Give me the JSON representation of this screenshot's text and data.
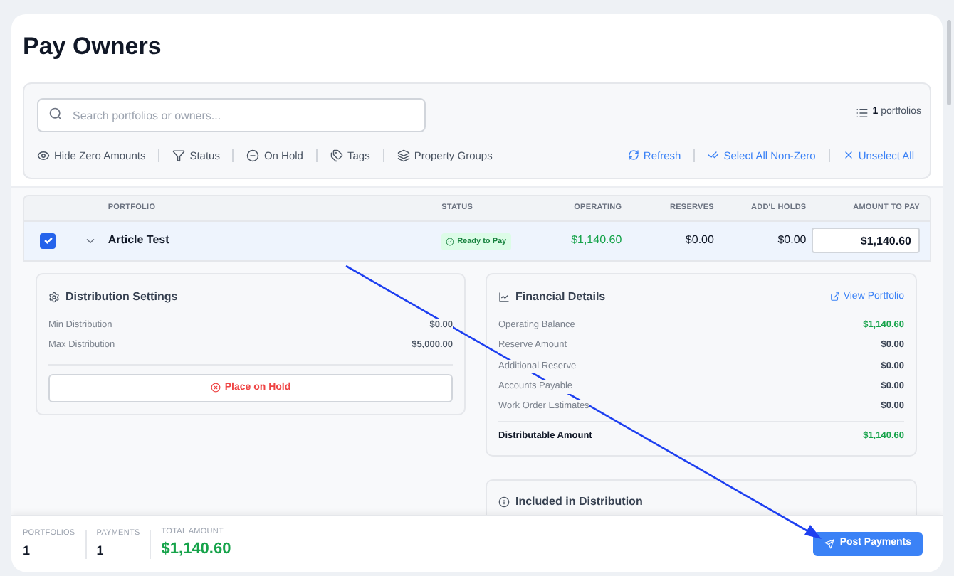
{
  "page": {
    "title": "Pay Owners"
  },
  "search": {
    "placeholder": "Search portfolios or owners..."
  },
  "portfolio_count": {
    "count": "1",
    "label": "portfolios"
  },
  "filters": [
    {
      "kind": "eye",
      "label": "Hide Zero Amounts"
    },
    {
      "kind": "filter",
      "label": "Status"
    },
    {
      "kind": "hold",
      "label": "On Hold"
    },
    {
      "kind": "tags",
      "label": "Tags"
    },
    {
      "kind": "layers",
      "label": "Property Groups"
    }
  ],
  "actions": [
    {
      "kind": "refresh",
      "label": "Refresh"
    },
    {
      "kind": "check",
      "label": "Select All Non-Zero"
    },
    {
      "kind": "x",
      "label": "Unselect All"
    }
  ],
  "table": {
    "columns": [
      "PORTFOLIO",
      "STATUS",
      "OPERATING",
      "RESERVES",
      "ADD'L HOLDS",
      "AMOUNT TO PAY"
    ],
    "rows": [
      {
        "checked": true,
        "expanded": true,
        "portfolio": "Article Test",
        "status": "Ready to Pay",
        "operating": "$1,140.60",
        "reserves": "$0.00",
        "holds": "$0.00",
        "amount": "$1,140.60"
      }
    ]
  },
  "distribution_settings": {
    "title": "Distribution Settings",
    "rows": [
      {
        "label": "Min Distribution",
        "value": "$0.00"
      },
      {
        "label": "Max Distribution",
        "value": "$5,000.00"
      }
    ],
    "button": "Place on Hold"
  },
  "financial_details": {
    "title": "Financial Details",
    "link": "View Portfolio",
    "rows": [
      {
        "label": "Operating Balance",
        "value": "$1,140.60",
        "positive": true
      },
      {
        "label": "Reserve Amount",
        "value": "$0.00",
        "positive": false
      },
      {
        "label": "Additional Reserve",
        "value": "$0.00",
        "positive": false
      },
      {
        "label": "Accounts Payable",
        "value": "$0.00",
        "positive": false
      },
      {
        "label": "Work Order Estimates",
        "value": "$0.00",
        "positive": false
      }
    ],
    "total": {
      "label": "Distributable Amount",
      "value": "$1,140.60"
    }
  },
  "included": {
    "title": "Included in Distribution"
  },
  "footer": {
    "stats": [
      {
        "label": "PORTFOLIOS",
        "value": "1",
        "kind": "count"
      },
      {
        "label": "PAYMENTS",
        "value": "1",
        "kind": "count"
      },
      {
        "label": "TOTAL AMOUNT",
        "value": "$1,140.60",
        "kind": "money"
      }
    ],
    "button": "Post Payments"
  }
}
